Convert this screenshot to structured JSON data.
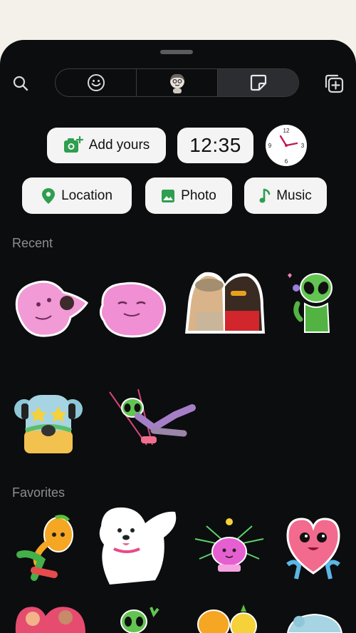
{
  "tabs": [
    {
      "name": "emoji"
    },
    {
      "name": "avatar"
    },
    {
      "name": "stickers",
      "selected": true
    }
  ],
  "quick_stickers": {
    "add_yours": "Add yours",
    "time": "12:35",
    "location": "Location",
    "photo": "Photo",
    "music": "Music",
    "clock_labels": {
      "twelve": "12",
      "three": "3",
      "six": "6",
      "nine": "9"
    }
  },
  "sections": {
    "recent": "Recent",
    "favorites": "Favorites"
  },
  "colors": {
    "sheet_bg": "#0c0d0e",
    "pill_bg": "#f4f4f4",
    "accent_green": "#2e9e4f",
    "clock_hand": "#c2185b"
  }
}
